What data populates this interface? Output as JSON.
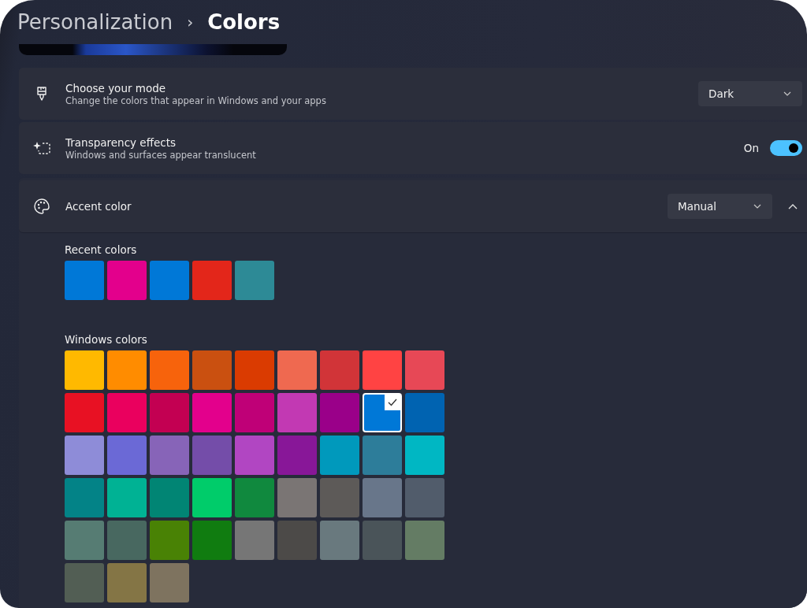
{
  "breadcrumb": {
    "parent": "Personalization",
    "separator": "›",
    "current": "Colors"
  },
  "settings": [
    {
      "kind": "dropdown",
      "title": "Choose your mode",
      "description": "Change the colors that appear in Windows and your apps",
      "value": "Dark"
    },
    {
      "kind": "toggle",
      "title": "Transparency effects",
      "description": "Windows and surfaces appear translucent",
      "state_label": "On",
      "on": true
    }
  ],
  "accent": {
    "title": "Accent color",
    "value": "Manual",
    "expanded": true,
    "recent_label": "Recent colors",
    "recent_colors": [
      {
        "color": "#0078d7"
      },
      {
        "color": "#e3008c"
      },
      {
        "color": "#0078d7"
      },
      {
        "color": "#e3261a"
      },
      {
        "color": "#2d8a96"
      }
    ],
    "windows_label": "Windows colors",
    "windows_colors": [
      {
        "color": "#ffb900",
        "selected": false
      },
      {
        "color": "#ff8c00",
        "selected": false
      },
      {
        "color": "#f7630c",
        "selected": false
      },
      {
        "color": "#ca5010",
        "selected": false
      },
      {
        "color": "#da3b01",
        "selected": false
      },
      {
        "color": "#ef6950",
        "selected": false
      },
      {
        "color": "#d13438",
        "selected": false
      },
      {
        "color": "#ff4343",
        "selected": false
      },
      {
        "color": "#e74856",
        "selected": false
      },
      {
        "color": "#e81123",
        "selected": false
      },
      {
        "color": "#ea005e",
        "selected": false
      },
      {
        "color": "#c30052",
        "selected": false
      },
      {
        "color": "#e3008c",
        "selected": false
      },
      {
        "color": "#bf0077",
        "selected": false
      },
      {
        "color": "#c239b3",
        "selected": false
      },
      {
        "color": "#9a0089",
        "selected": false
      },
      {
        "color": "#0078d7",
        "selected": true
      },
      {
        "color": "#0063b1",
        "selected": false
      },
      {
        "color": "#8e8cd8",
        "selected": false
      },
      {
        "color": "#6b69d6",
        "selected": false
      },
      {
        "color": "#8764b8",
        "selected": false
      },
      {
        "color": "#744da9",
        "selected": false
      },
      {
        "color": "#b146c2",
        "selected": false
      },
      {
        "color": "#881798",
        "selected": false
      },
      {
        "color": "#0099bc",
        "selected": false
      },
      {
        "color": "#2d7d9a",
        "selected": false
      },
      {
        "color": "#00b7c3",
        "selected": false
      },
      {
        "color": "#038387",
        "selected": false
      },
      {
        "color": "#00b294",
        "selected": false
      },
      {
        "color": "#018574",
        "selected": false
      },
      {
        "color": "#00cc6a",
        "selected": false
      },
      {
        "color": "#10893e",
        "selected": false
      },
      {
        "color": "#7a7574",
        "selected": false
      },
      {
        "color": "#5d5a58",
        "selected": false
      },
      {
        "color": "#68768a",
        "selected": false
      },
      {
        "color": "#515c6b",
        "selected": false
      },
      {
        "color": "#567c73",
        "selected": false
      },
      {
        "color": "#486860",
        "selected": false
      },
      {
        "color": "#498205",
        "selected": false
      },
      {
        "color": "#107c10",
        "selected": false
      },
      {
        "color": "#767676",
        "selected": false
      },
      {
        "color": "#4c4a48",
        "selected": false
      },
      {
        "color": "#69797e",
        "selected": false
      },
      {
        "color": "#4a5459",
        "selected": false
      },
      {
        "color": "#647c64",
        "selected": false
      },
      {
        "color": "#525e54",
        "selected": false
      },
      {
        "color": "#847545",
        "selected": false
      },
      {
        "color": "#7e735f",
        "selected": false
      }
    ]
  }
}
